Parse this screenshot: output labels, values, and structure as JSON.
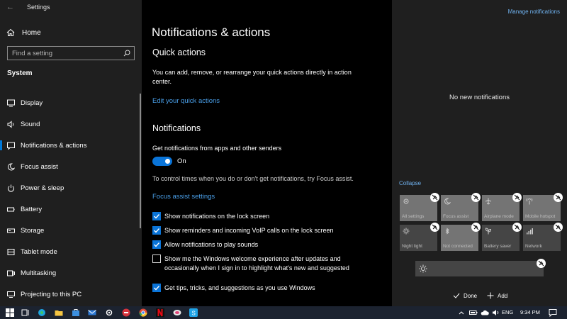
{
  "window": {
    "title": "Settings"
  },
  "sidebar": {
    "home_label": "Home",
    "search_placeholder": "Find a setting",
    "section_title": "System",
    "items": [
      {
        "label": "Display",
        "icon": "display-icon"
      },
      {
        "label": "Sound",
        "icon": "speaker-icon"
      },
      {
        "label": "Notifications & actions",
        "icon": "notification-icon",
        "selected": true
      },
      {
        "label": "Focus assist",
        "icon": "moon-icon"
      },
      {
        "label": "Power & sleep",
        "icon": "power-icon"
      },
      {
        "label": "Battery",
        "icon": "battery-icon"
      },
      {
        "label": "Storage",
        "icon": "storage-icon"
      },
      {
        "label": "Tablet mode",
        "icon": "tablet-icon"
      },
      {
        "label": "Multitasking",
        "icon": "multitasking-icon"
      },
      {
        "label": "Projecting to this PC",
        "icon": "projector-icon"
      }
    ]
  },
  "main": {
    "title": "Notifications & actions",
    "quick_actions": {
      "heading": "Quick actions",
      "description": "You can add, remove, or rearrange your quick actions directly in action center.",
      "edit_link": "Edit your quick actions"
    },
    "notifications": {
      "heading": "Notifications",
      "toggle_label": "Get notifications from apps and other senders",
      "toggle_state": "On",
      "focus_text": "To control times when you do or don't get notifications, try Focus assist.",
      "focus_link": "Focus assist settings",
      "checkboxes": [
        {
          "label": "Show notifications on the lock screen",
          "checked": true
        },
        {
          "label": "Show reminders and incoming VoIP calls on the lock screen",
          "checked": true
        },
        {
          "label": "Allow notifications to play sounds",
          "checked": true
        },
        {
          "label": "Show me the Windows welcome experience after updates and occasionally when I sign in to highlight what's new and suggested",
          "checked": false
        },
        {
          "label": "Get tips, tricks, and suggestions as you use Windows",
          "checked": true
        }
      ]
    }
  },
  "action_center": {
    "manage_link": "Manage notifications",
    "empty_text": "No new notifications",
    "collapse_label": "Collapse",
    "tiles": [
      {
        "label": "All settings",
        "icon": "gear-icon",
        "light": true
      },
      {
        "label": "Focus assist",
        "icon": "moon-icon",
        "light": true
      },
      {
        "label": "Airplane mode",
        "icon": "airplane-icon",
        "light": true
      },
      {
        "label": "Mobile hotspot",
        "icon": "hotspot-icon",
        "light": true
      },
      {
        "label": "Night light",
        "icon": "sun-icon",
        "light": false
      },
      {
        "label": "Not connected",
        "icon": "bluetooth-icon",
        "light": true
      },
      {
        "label": "Battery saver",
        "icon": "battery-saver-icon",
        "light": false
      },
      {
        "label": "Network",
        "icon": "network-icon",
        "light": false
      }
    ],
    "done_label": "Done",
    "add_label": "Add"
  },
  "taskbar": {
    "language": "ENG",
    "time": "9:34 PM",
    "accent": "#0078d7"
  }
}
